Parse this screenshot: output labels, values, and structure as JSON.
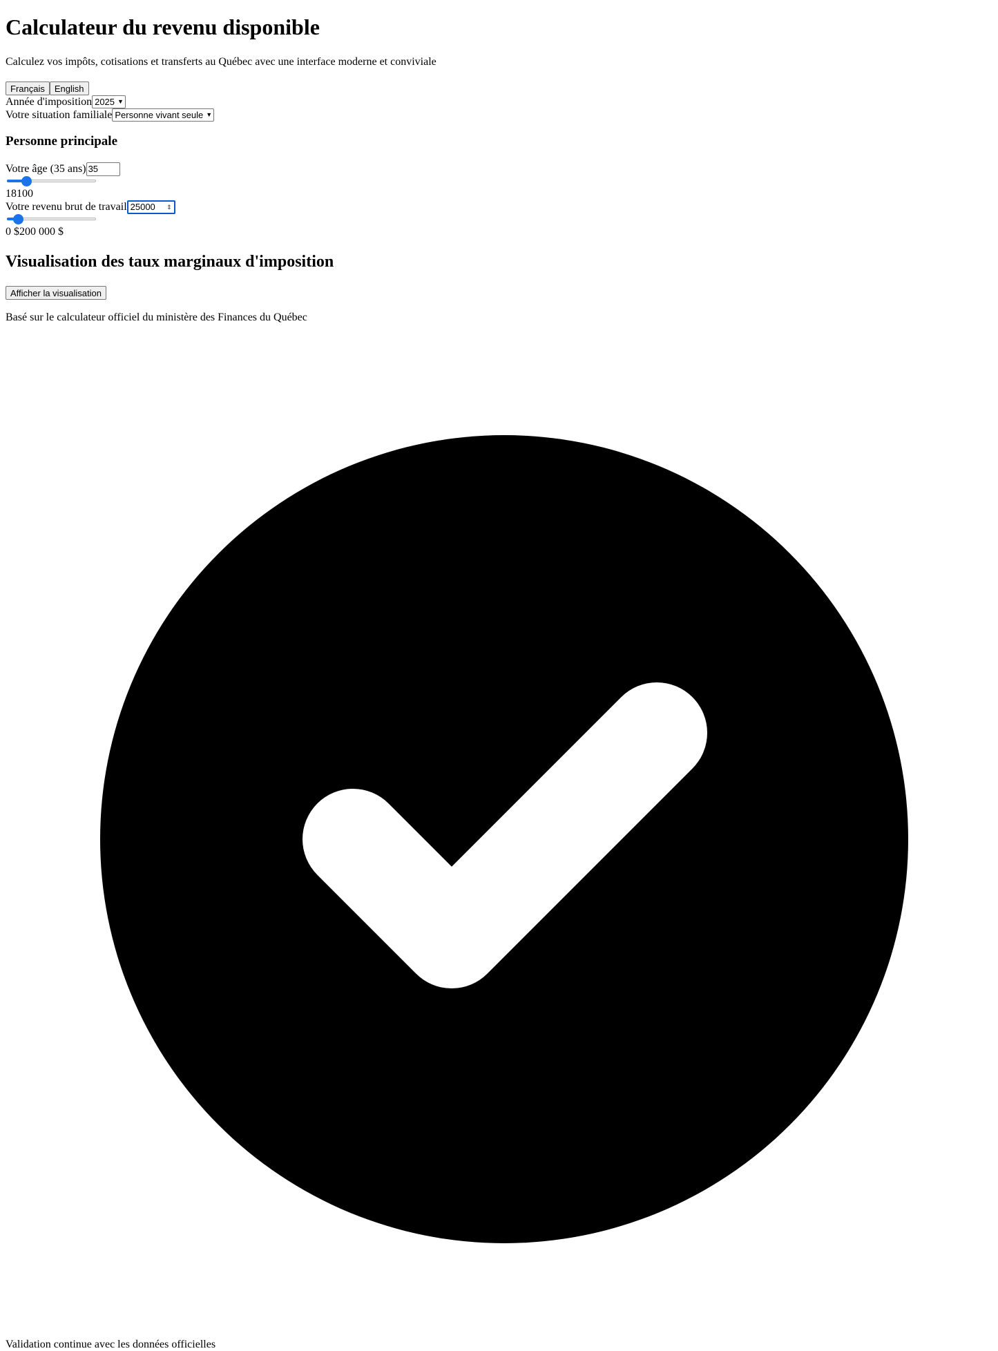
{
  "header": {
    "title": "Calculateur du revenu disponible",
    "subtitle": "Calculez vos impôts, cotisations et transferts au Québec avec une interface moderne et conviviale"
  },
  "language": {
    "french_label": "Français",
    "english_label": "English"
  },
  "tax_year": {
    "label": "Année d'imposition",
    "value": "2025"
  },
  "family_situation": {
    "label": "Votre situation familiale",
    "value": "Personne vivant seule"
  },
  "main_person": {
    "heading": "Personne principale",
    "age": {
      "label": "Votre âge (35 ans)",
      "value": "35",
      "slider_fraction": 0.22,
      "range_text": "18100"
    },
    "income": {
      "label": "Votre revenu brut de travail",
      "value": "25000",
      "slider_fraction": 0.125,
      "range_text": "0 $200 000 $"
    }
  },
  "visualization": {
    "heading": "Visualisation des taux marginaux d'imposition",
    "button_label": "Afficher la visualisation"
  },
  "source_note": "Basé sur le calculateur officiel du ministère des Finances du Québec",
  "validation_note": "Validation continue avec les données officielles",
  "icons": {
    "status_icon": "check-circle-icon"
  },
  "colors": {
    "accent": "#1a73e8",
    "focus": "#0b57d0"
  }
}
